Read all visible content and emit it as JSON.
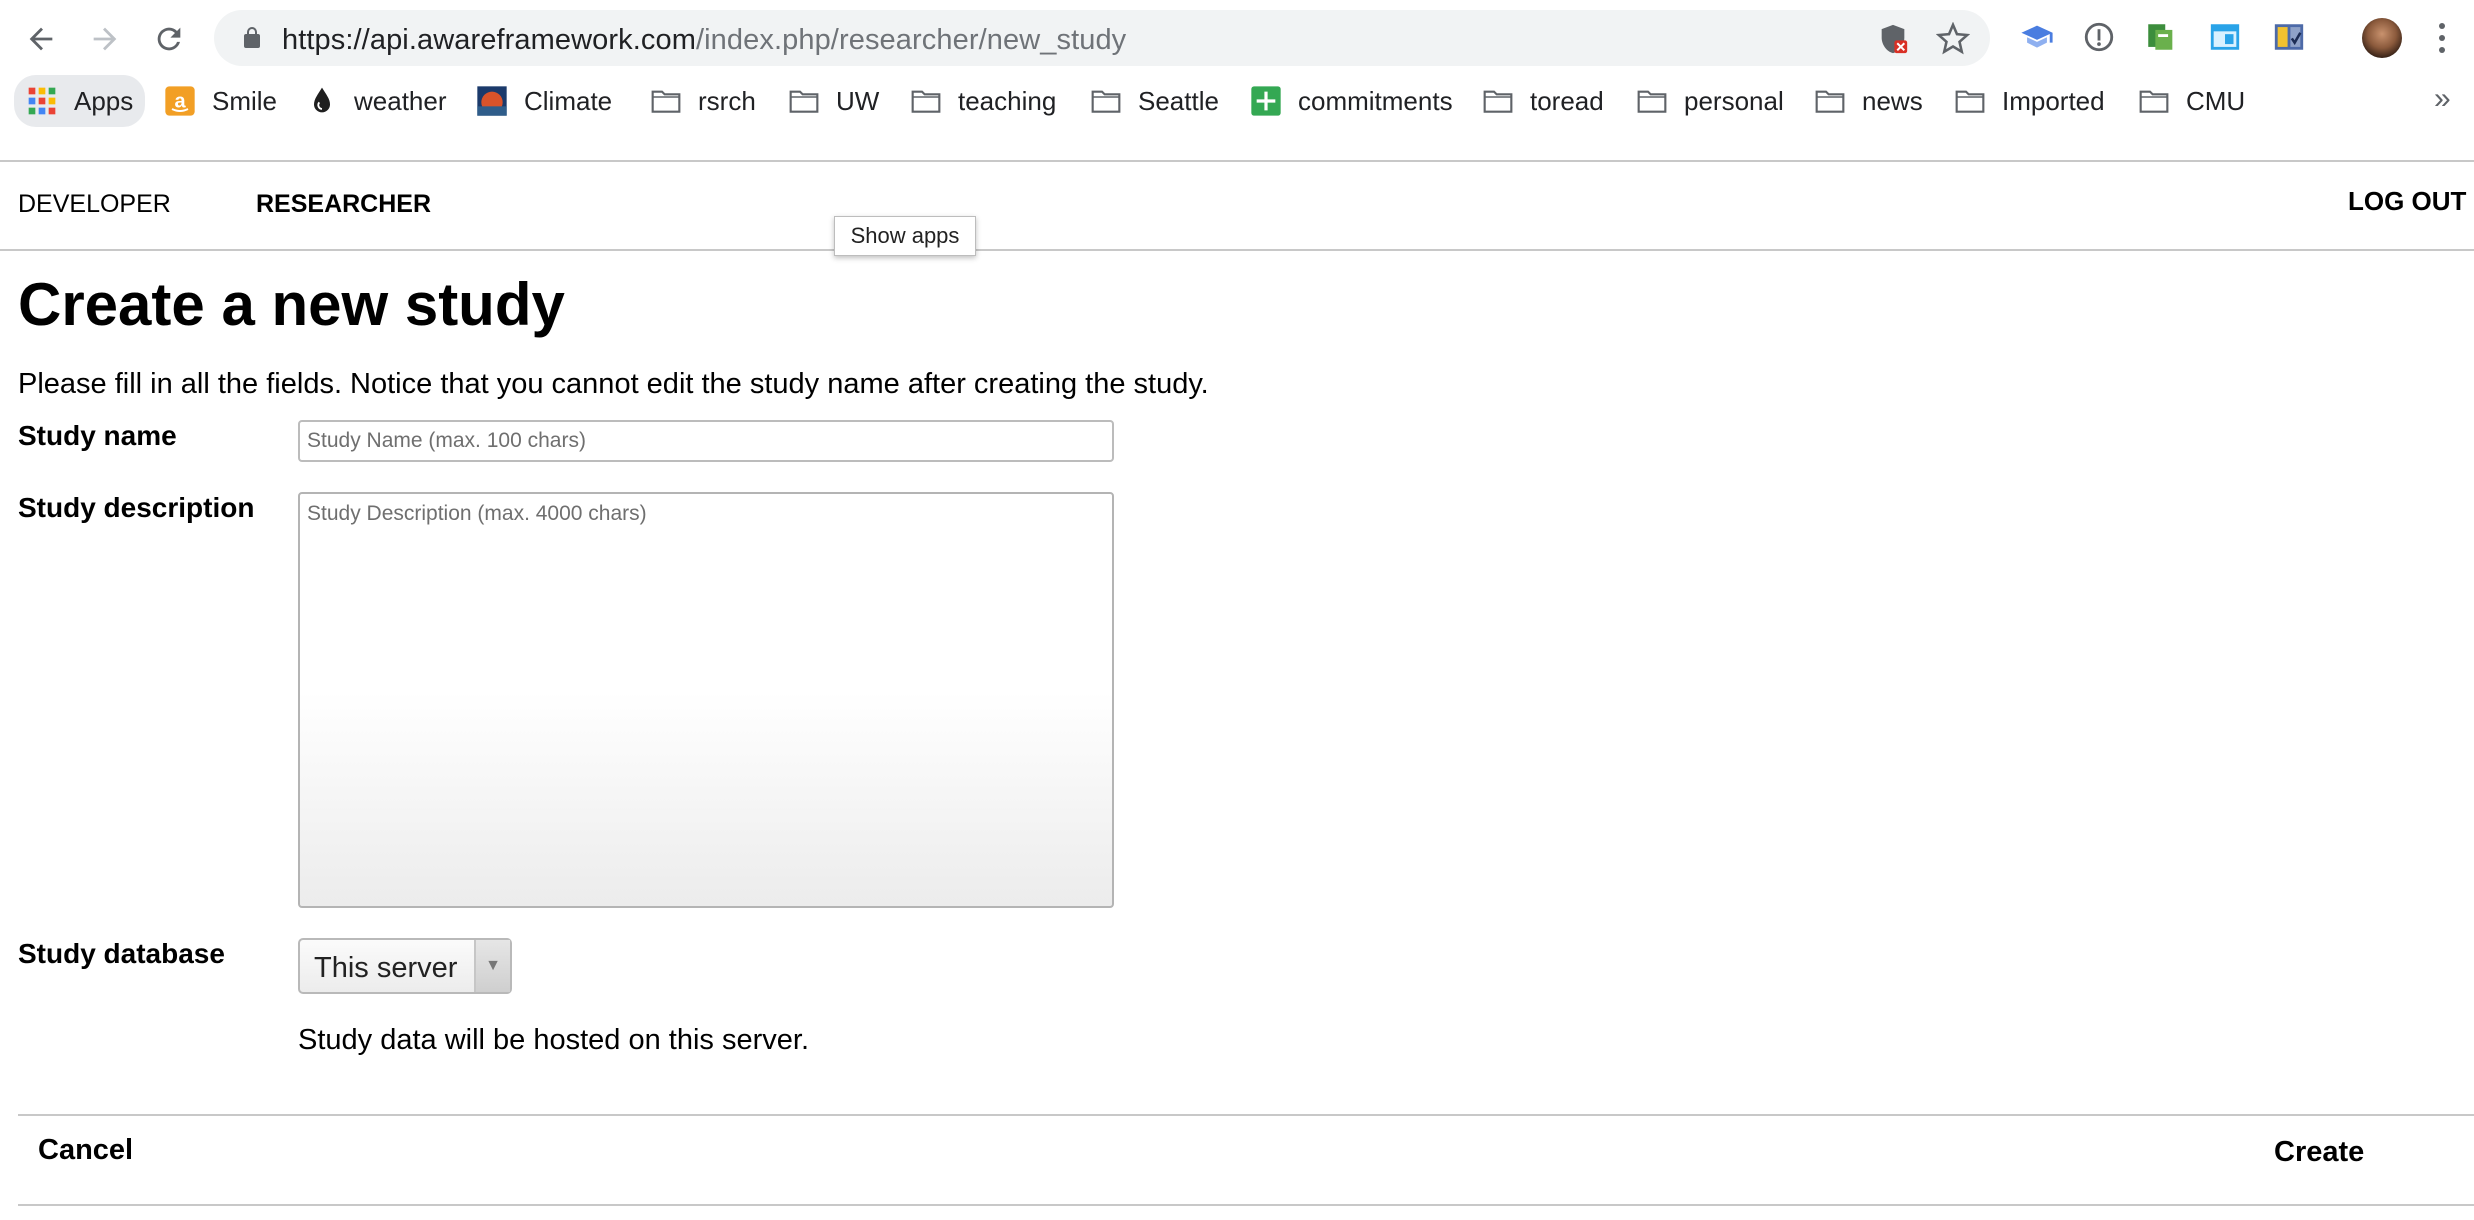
{
  "browser": {
    "url_host": "https://api.awareframework.com",
    "url_path": "/index.php/researcher/new_study",
    "bookmarks": [
      {
        "label": "Apps",
        "icon": "apps-grid-icon"
      },
      {
        "label": "Smile",
        "icon": "amazon-icon"
      },
      {
        "label": "weather",
        "icon": "weather-drop-icon"
      },
      {
        "label": "Climate",
        "icon": "climate-image-icon"
      },
      {
        "label": "rsrch",
        "icon": "folder-icon"
      },
      {
        "label": "UW",
        "icon": "folder-icon"
      },
      {
        "label": "teaching",
        "icon": "folder-icon"
      },
      {
        "label": "Seattle",
        "icon": "folder-icon"
      },
      {
        "label": "commitments",
        "icon": "sheets-icon"
      },
      {
        "label": "toread",
        "icon": "folder-icon"
      },
      {
        "label": "personal",
        "icon": "folder-icon"
      },
      {
        "label": "news",
        "icon": "folder-icon"
      },
      {
        "label": "Imported",
        "icon": "folder-icon"
      },
      {
        "label": "CMU",
        "icon": "folder-icon"
      }
    ],
    "overflow_label": "»",
    "tooltip": "Show apps"
  },
  "nav": {
    "developer": "DEVELOPER",
    "researcher": "RESEARCHER",
    "logout": "LOG OUT"
  },
  "page": {
    "title": "Create a new study",
    "intro": "Please fill in all the fields. Notice that you cannot edit the study name after creating the study."
  },
  "form": {
    "name_label": "Study name",
    "name_placeholder": "Study Name (max. 100 chars)",
    "name_value": "",
    "description_label": "Study description",
    "description_placeholder": "Study Description (max. 4000 chars)",
    "description_value": "",
    "database_label": "Study database",
    "database_selected": "This server",
    "database_help": "Study data will be hosted on this server."
  },
  "footer": {
    "cancel": "Cancel",
    "create": "Create"
  },
  "colors": {
    "omnibox_bg": "#f1f3f4",
    "rule": "#c8c8c8",
    "url_path": "#6f7378"
  }
}
